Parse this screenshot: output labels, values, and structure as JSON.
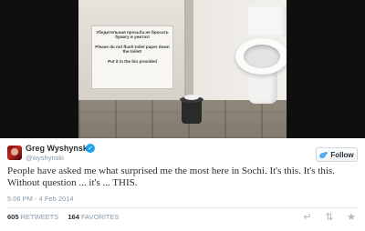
{
  "photo": {
    "sign": {
      "line_ru": "Убедительная просьба не бросать бумагу в унитаз!",
      "line_en": "Please do not flush toilet paper down the toilet!",
      "line_bin": "Put it in the bin provided"
    }
  },
  "tweet": {
    "author_name": "Greg Wyshynski",
    "author_handle": "@wyshynski",
    "verified_glyph": "✓",
    "follow_label": "Follow",
    "text": "People have asked me what surprised me the most here in Sochi. It's this. It's this. Without question ... it's ... THIS.",
    "timestamp": "5:06 PM - 4 Feb 2014",
    "retweets_count": "605",
    "retweets_label": "RETWEETS",
    "favorites_count": "164",
    "favorites_label": "FAVORITES",
    "icons": [
      "reply-icon",
      "retweet-icon",
      "favorite-icon"
    ],
    "accent_color": "#1da1f2"
  }
}
